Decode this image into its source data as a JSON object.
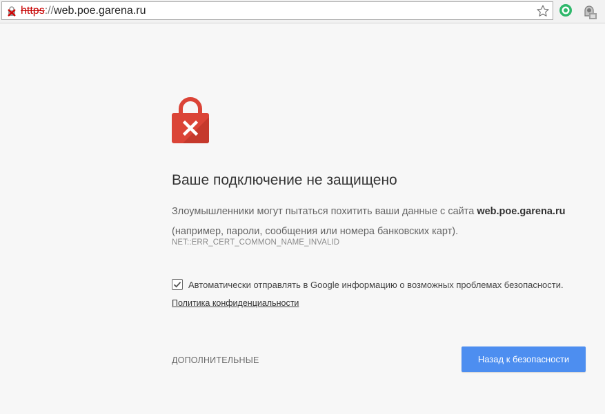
{
  "address_bar": {
    "url_scheme": "https",
    "url_separator": "://",
    "url_host": "web.poe.garena.ru"
  },
  "icons": {
    "security_indicator": "broken-lock-icon",
    "bookmark": "star-icon",
    "extension_1": "green-circle-extension-icon",
    "extension_2": "gray-extension-icon",
    "page_icon": "red-padlock-x-icon"
  },
  "interstitial": {
    "heading": "Ваше подключение не защищено",
    "description_prefix": "Злоумышленники могут пытаться похитить ваши данные с сайта ",
    "description_site": "web.poe.garena.ru",
    "description_suffix": " (например, пароли, сообщения или номера банковских карт).",
    "error_code": "NET::ERR_CERT_COMMON_NAME_INVALID",
    "report_checkbox_label": "Автоматически отправлять в Google информацию о возможных проблемах безопасности.",
    "report_checkbox_checked": true,
    "privacy_link": "Политика конфиденциальности",
    "details_link": "ДОПОЛНИТЕЛЬНЫЕ",
    "back_button": "Назад к безопасности"
  },
  "colors": {
    "lock_red": "#db4437",
    "button_blue": "#4d8ef0",
    "insecure_scheme": "#c70000"
  }
}
